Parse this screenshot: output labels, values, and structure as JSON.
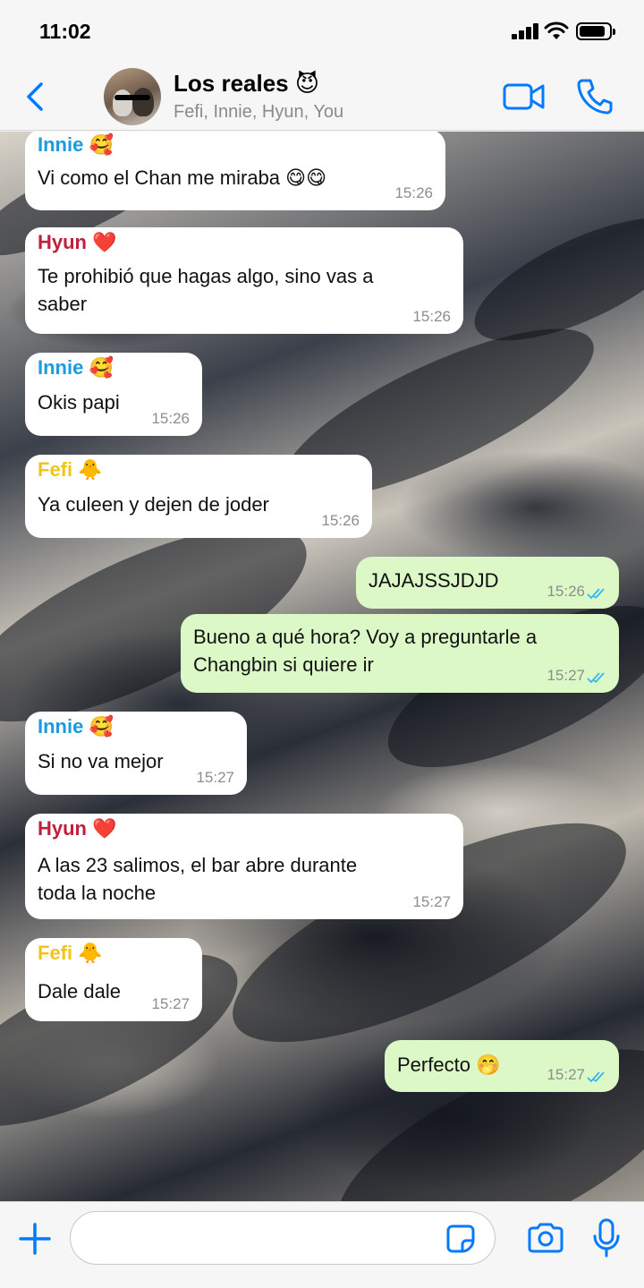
{
  "status_bar": {
    "time": "11:02"
  },
  "header": {
    "title": "Los reales 😈",
    "subtitle": "Fefi, Innie, Hyun, You"
  },
  "colors": {
    "accent": "#007aff",
    "innie": "#1a9be0",
    "hyun": "#c0203b",
    "fefi": "#f0c419",
    "outgoing_bubble": "#dcf8c6",
    "incoming_bubble": "#ffffff",
    "read_ticks": "#34b7f1"
  },
  "icons": {
    "back": "chevron-left-icon",
    "video": "video-camera-icon",
    "call": "phone-icon",
    "plus": "plus-icon",
    "sticker": "sticker-icon",
    "camera": "camera-icon",
    "mic": "microphone-icon"
  },
  "messages": [
    {
      "direction": "in",
      "sender": "Innie 🥰",
      "lines": [
        "Vi como el Chan me miraba 😋😋"
      ],
      "time": "15:26"
    },
    {
      "direction": "in",
      "sender": "Hyun ❤️",
      "lines": [
        "Te prohibió que hagas algo, sino vas a",
        "saber"
      ],
      "time": "15:26"
    },
    {
      "direction": "in",
      "sender": "Innie 🥰",
      "lines": [
        "Okis papi"
      ],
      "time": "15:26"
    },
    {
      "direction": "in",
      "sender": "Fefi 🐥",
      "lines": [
        "Ya culeen y dejen de joder"
      ],
      "time": "15:26"
    },
    {
      "direction": "out",
      "lines": [
        "JAJAJSSJDJD"
      ],
      "time": "15:26",
      "status": "read"
    },
    {
      "direction": "out",
      "lines": [
        "Bueno a qué hora? Voy a preguntarle a",
        "Changbin si quiere ir"
      ],
      "time": "15:27",
      "status": "read"
    },
    {
      "direction": "in",
      "sender": "Innie 🥰",
      "lines": [
        "Si no va mejor"
      ],
      "time": "15:27"
    },
    {
      "direction": "in",
      "sender": "Hyun ❤️",
      "lines": [
        "A las 23 salimos, el bar abre durante",
        "toda la noche"
      ],
      "time": "15:27"
    },
    {
      "direction": "in",
      "sender": "Fefi 🐥",
      "lines": [
        "Dale dale"
      ],
      "time": "15:27"
    },
    {
      "direction": "out",
      "lines": [
        "Perfecto 🤭"
      ],
      "time": "15:27",
      "status": "read"
    }
  ],
  "composer": {
    "placeholder": ""
  }
}
